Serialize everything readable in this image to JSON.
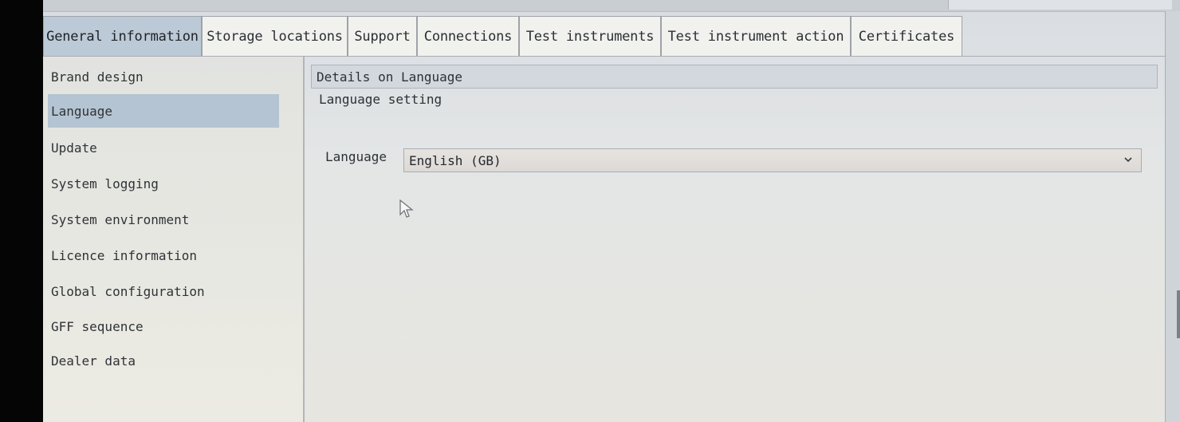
{
  "tabs": [
    {
      "label": "General information",
      "active": true
    },
    {
      "label": "Storage locations",
      "active": false
    },
    {
      "label": "Support",
      "active": false
    },
    {
      "label": "Connections",
      "active": false
    },
    {
      "label": "Test instruments",
      "active": false
    },
    {
      "label": "Test instrument action",
      "active": false
    },
    {
      "label": "Certificates",
      "active": false
    }
  ],
  "sidebar": {
    "items": [
      {
        "label": "Brand design"
      },
      {
        "label": "Language",
        "selected": true
      },
      {
        "label": "Update"
      },
      {
        "label": "System logging"
      },
      {
        "label": "System environment"
      },
      {
        "label": "Licence information"
      },
      {
        "label": "Global configuration"
      },
      {
        "label": "GFF sequence"
      },
      {
        "label": "Dealer data"
      }
    ]
  },
  "content": {
    "header": "Details on Language",
    "setting_title": "Language setting",
    "language_label": "Language",
    "language_value": "English (GB)"
  },
  "icons": {
    "dropdown": "chevron-down-icon",
    "pointer": "mouse-pointer-icon"
  },
  "colors": {
    "active_tab": "#bcc9d6",
    "selected_item": "#b5c4d2"
  }
}
